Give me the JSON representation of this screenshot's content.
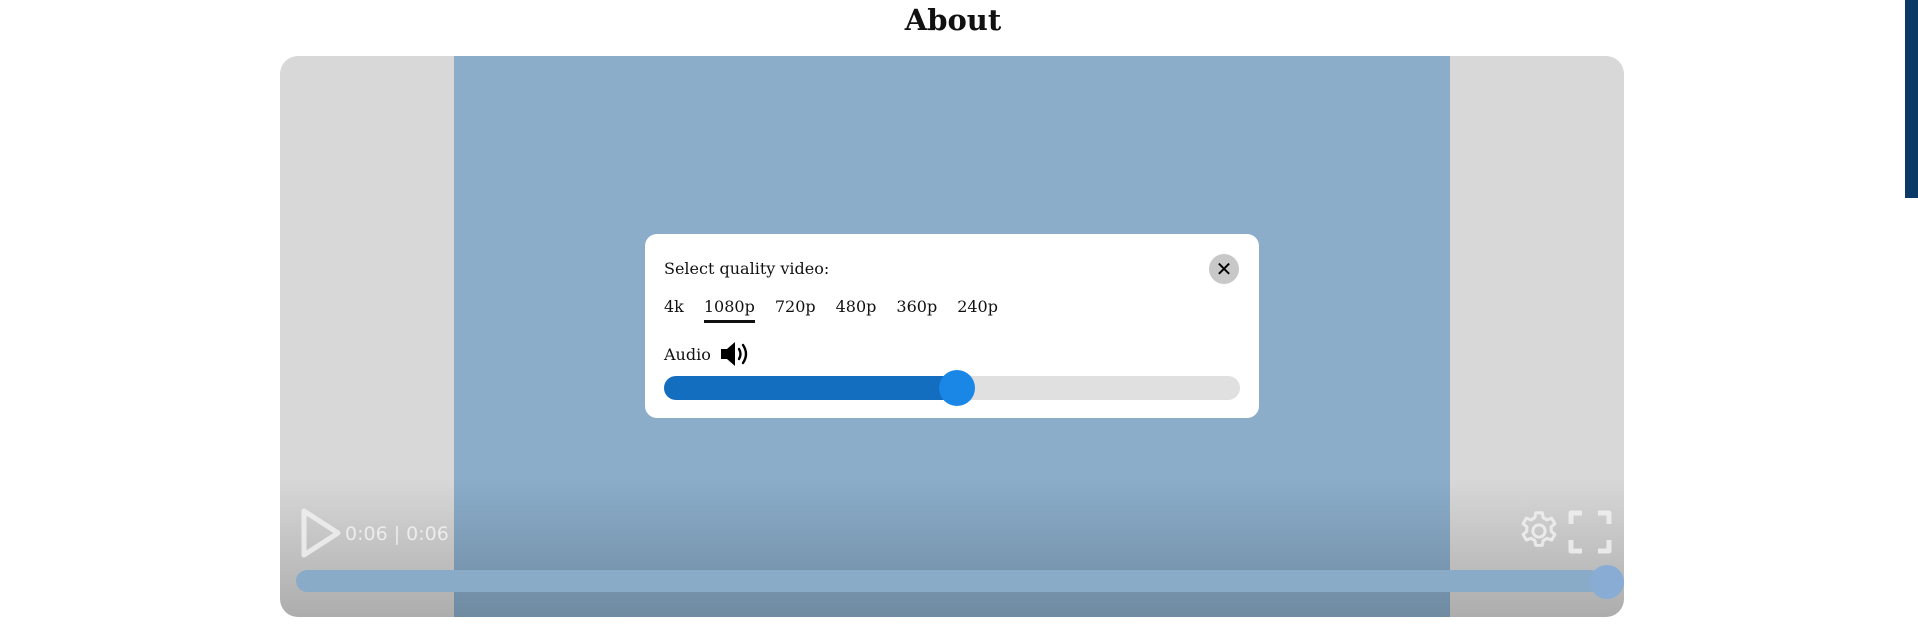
{
  "page": {
    "title": "About"
  },
  "player": {
    "time_display": "0:06 | 0:06",
    "progress_fraction": 1.0,
    "icons": {
      "play": "play-icon",
      "settings": "gear-icon",
      "fullscreen": "fullscreen-icon"
    }
  },
  "quality_modal": {
    "title": "Select quality video:",
    "close_icon": "close-icon",
    "close_label": "✕",
    "options": [
      "4k",
      "1080p",
      "720p",
      "480p",
      "360p",
      "240p"
    ],
    "selected": "1080p",
    "audio_label": "Audio",
    "audio_icon": "speaker-icon",
    "volume_fraction": 0.508
  },
  "colors": {
    "video_bg": "#8badca",
    "accent": "#136ec0",
    "knob": "#1a86e6",
    "scrollbar": "#0b3a66"
  }
}
